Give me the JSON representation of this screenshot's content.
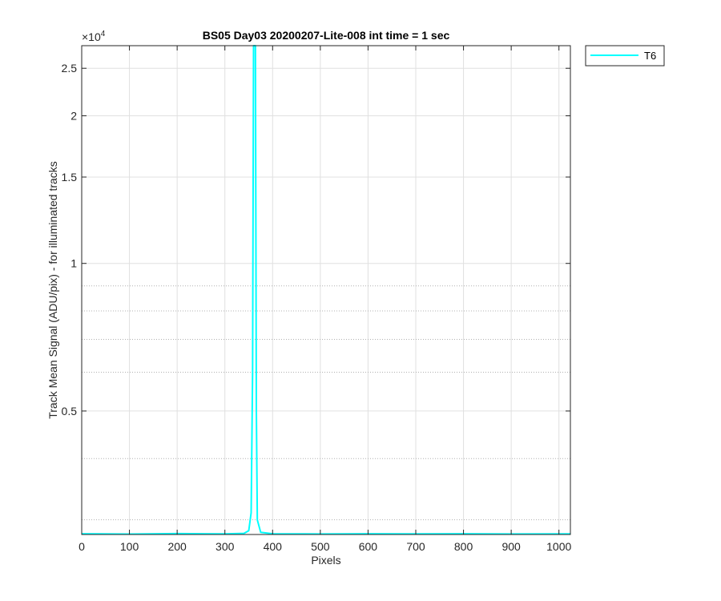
{
  "chart_data": {
    "type": "line",
    "title": "BS05 Day03 20200207-Lite-008 int time = 1 sec",
    "xlabel": "Pixels",
    "ylabel": "Track Mean Signal (ADU/pix) - for illuminated tracks",
    "exponent_label": "×10",
    "exponent_power": "4",
    "xlim": [
      0,
      1024
    ],
    "ylim": [
      2800,
      27800
    ],
    "yscale": "log",
    "grid": true,
    "minor_grid": true,
    "xticks": [
      0,
      100,
      200,
      300,
      400,
      500,
      600,
      700,
      800,
      900,
      1000
    ],
    "xtick_labels": [
      "0",
      "100",
      "200",
      "300",
      "400",
      "500",
      "600",
      "700",
      "800",
      "900",
      "1000"
    ],
    "yticks": [
      5000,
      10000,
      15000,
      20000,
      25000
    ],
    "ytick_labels": [
      "0.5",
      "1",
      "1.5",
      "2",
      "2.5"
    ],
    "legend_position": "outside-top-right",
    "series": [
      {
        "name": "T6",
        "color": "#00FFFF",
        "x": [
          0,
          100,
          200,
          300,
          340,
          350,
          355,
          358,
          360,
          362,
          364,
          366,
          368,
          375,
          400,
          500,
          600,
          700,
          800,
          900,
          1024
        ],
        "y": [
          2810,
          2805,
          2812,
          2808,
          2815,
          2850,
          3100,
          6000,
          27800,
          27800,
          27800,
          5000,
          3000,
          2830,
          2810,
          2806,
          2809,
          2807,
          2810,
          2806,
          2808
        ]
      }
    ]
  }
}
